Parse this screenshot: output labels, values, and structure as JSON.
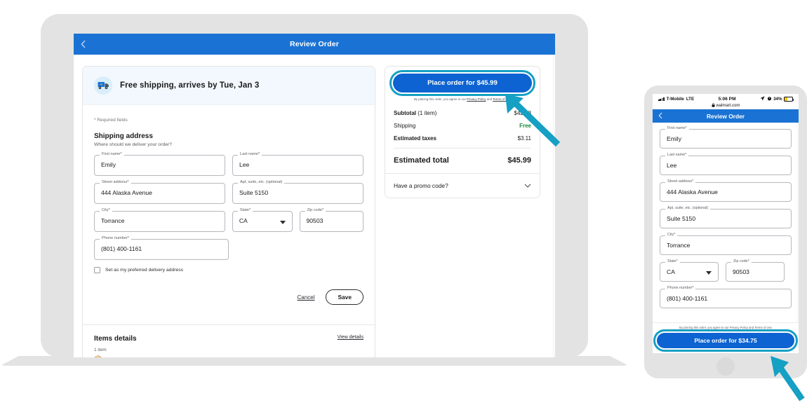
{
  "accent": {
    "walmart_blue": "#0d63d1",
    "header_blue": "#1a73d4",
    "highlight_teal": "#15a0c4",
    "free_green": "#1a8a3b"
  },
  "laptop": {
    "header": {
      "back_icon": "chevron-left-icon",
      "title": "Review Order"
    },
    "shipping_banner": {
      "icon": "delivery-truck-icon",
      "text": "Free shipping, arrives by Tue, Jan 3"
    },
    "required_note": "* Required fields",
    "section": {
      "title": "Shipping address",
      "subtitle": "Where should we deliver your order?"
    },
    "fields": [
      {
        "label": "First name*",
        "value": "Emily",
        "type": "text"
      },
      {
        "label": "Last name*",
        "value": "Lee",
        "type": "text"
      },
      {
        "label": "Street address*",
        "value": "444 Alaska Avenue",
        "type": "text"
      },
      {
        "label": "Apt, suite, etc. (optional)",
        "value": "Suite 5150",
        "type": "text"
      },
      {
        "label": "City*",
        "value": "Torrance",
        "type": "text"
      },
      {
        "label": "State*",
        "value": "CA",
        "type": "select"
      },
      {
        "label": "Zip code*",
        "value": "90503",
        "type": "text"
      },
      {
        "label": "Phone number*",
        "value": "(801) 400-1161",
        "type": "tel"
      }
    ],
    "checkbox": {
      "label": "Set as my preferred delivery address",
      "checked": false
    },
    "cancel_label": "Cancel",
    "save_label": "Save",
    "items": {
      "title": "Items details",
      "view_link": "View details",
      "count": "1 item",
      "thumb": "📦"
    },
    "summary": {
      "place_order_label": "Place order for $45.99",
      "legal_prefix": "By placing this order, you agree to our ",
      "legal_link1": "Privacy Policy",
      "legal_mid": " and ",
      "legal_link2": "Terms of Use",
      "rows": [
        {
          "label_bold": "Subtotal",
          "label_rest": " (1 item)",
          "value": "$42.88",
          "style": "normal"
        },
        {
          "label_bold": "",
          "label_rest": "Shipping",
          "value": "Free",
          "style": "free"
        },
        {
          "label_bold": "Estimated taxes",
          "label_rest": "",
          "value": "$3.11",
          "style": "normal"
        }
      ],
      "total_label": "Estimated total",
      "total_value": "$45.99",
      "promo_label": "Have a promo code?",
      "promo_icon": "chevron-down-icon"
    }
  },
  "phone": {
    "status": {
      "carrier": "T-Mobile",
      "network": "LTE",
      "time": "5:06 PM",
      "battery_pct": "34%",
      "lock_icon": "lock-icon",
      "url": "walmart.com",
      "location_icon": "location-arrow-icon",
      "alarm_icon": "alarm-icon"
    },
    "header": {
      "back_icon": "chevron-left-icon",
      "title": "Review Order"
    },
    "fields": [
      {
        "label": "First name*",
        "value": "Emily",
        "type": "text"
      },
      {
        "label": "Last name*",
        "value": "Lee",
        "type": "text"
      },
      {
        "label": "Street address*",
        "value": "444 Alaska Avenue",
        "type": "text"
      },
      {
        "label": "Apt, suite, etc. (optional)",
        "value": "Suite 5150",
        "type": "text"
      },
      {
        "label": "City*",
        "value": "Torrance",
        "type": "text"
      },
      {
        "label": "State*",
        "value": "CA",
        "type": "select"
      },
      {
        "label": "Zip code*",
        "value": "90503",
        "type": "text"
      },
      {
        "label": "Phone number*",
        "value": "(801) 400-1161",
        "type": "tel"
      }
    ],
    "footer": {
      "legal_prefix": "By placing this order, you agree to our ",
      "legal_link1": "Privacy Policy",
      "legal_mid": " and ",
      "legal_link2": "Terms of Use",
      "place_order_label": "Place order for $34.75"
    }
  },
  "annotations": {
    "arrow_desktop": "arrow-pointing-to-place-order-desktop",
    "arrow_mobile": "arrow-pointing-to-place-order-mobile"
  }
}
